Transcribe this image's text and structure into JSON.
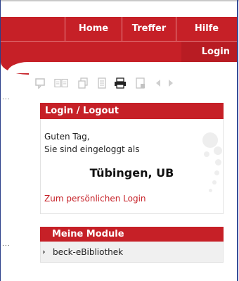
{
  "nav": {
    "items": [
      {
        "label": "Home"
      },
      {
        "label": "Treffer"
      },
      {
        "label": "Hilfe"
      }
    ],
    "login_label": "Login"
  },
  "toolbar": {
    "icons": [
      "bookmark-icon",
      "compare-icon",
      "copy-icon",
      "document-icon",
      "print-icon",
      "save-icon",
      "prev-icon",
      "next-icon"
    ]
  },
  "left_markers": [
    "...",
    "..."
  ],
  "login_box": {
    "title": "Login / Logout",
    "greeting_line1": "Guten Tag,",
    "greeting_line2": "Sie sind eingeloggt als",
    "user": "Tübingen, UB",
    "personal_login_link": "Zum persönlichen Login"
  },
  "modules": {
    "title": "Meine Module",
    "items": [
      {
        "label": "beck-eBibliothek"
      }
    ]
  },
  "colors": {
    "brand_red": "#c62027",
    "frame_blue": "#2a3f8a"
  }
}
